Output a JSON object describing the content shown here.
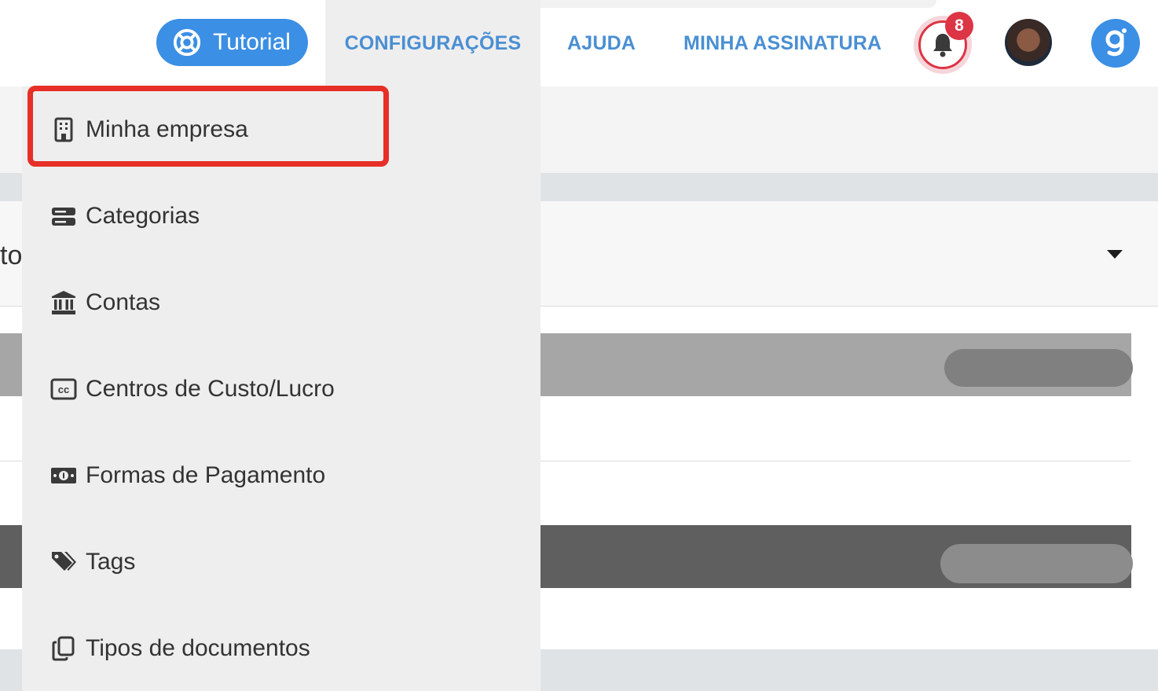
{
  "header": {
    "tutorial_label": "Tutorial",
    "nav": {
      "configuracoes": "CONFIGURAÇÕES",
      "ajuda": "AJUDA",
      "assinatura": "MINHA ASSINATURA"
    },
    "notifications_count": "8"
  },
  "background": {
    "partial_header_text": "to"
  },
  "dropdown": {
    "items": [
      {
        "label": "Minha empresa",
        "icon": "building-icon"
      },
      {
        "label": "Categorias",
        "icon": "server-icon"
      },
      {
        "label": "Contas",
        "icon": "bank-icon"
      },
      {
        "label": "Centros de Custo/Lucro",
        "icon": "cc-icon"
      },
      {
        "label": "Formas de Pagamento",
        "icon": "money-bill-icon"
      },
      {
        "label": "Tags",
        "icon": "tags-icon"
      },
      {
        "label": "Tipos de documentos",
        "icon": "copy-icon"
      }
    ]
  },
  "colors": {
    "accent": "#3b8fe4",
    "nav_link": "#4a8fd3",
    "badge": "#dc3545",
    "highlight": "#e62f26"
  }
}
